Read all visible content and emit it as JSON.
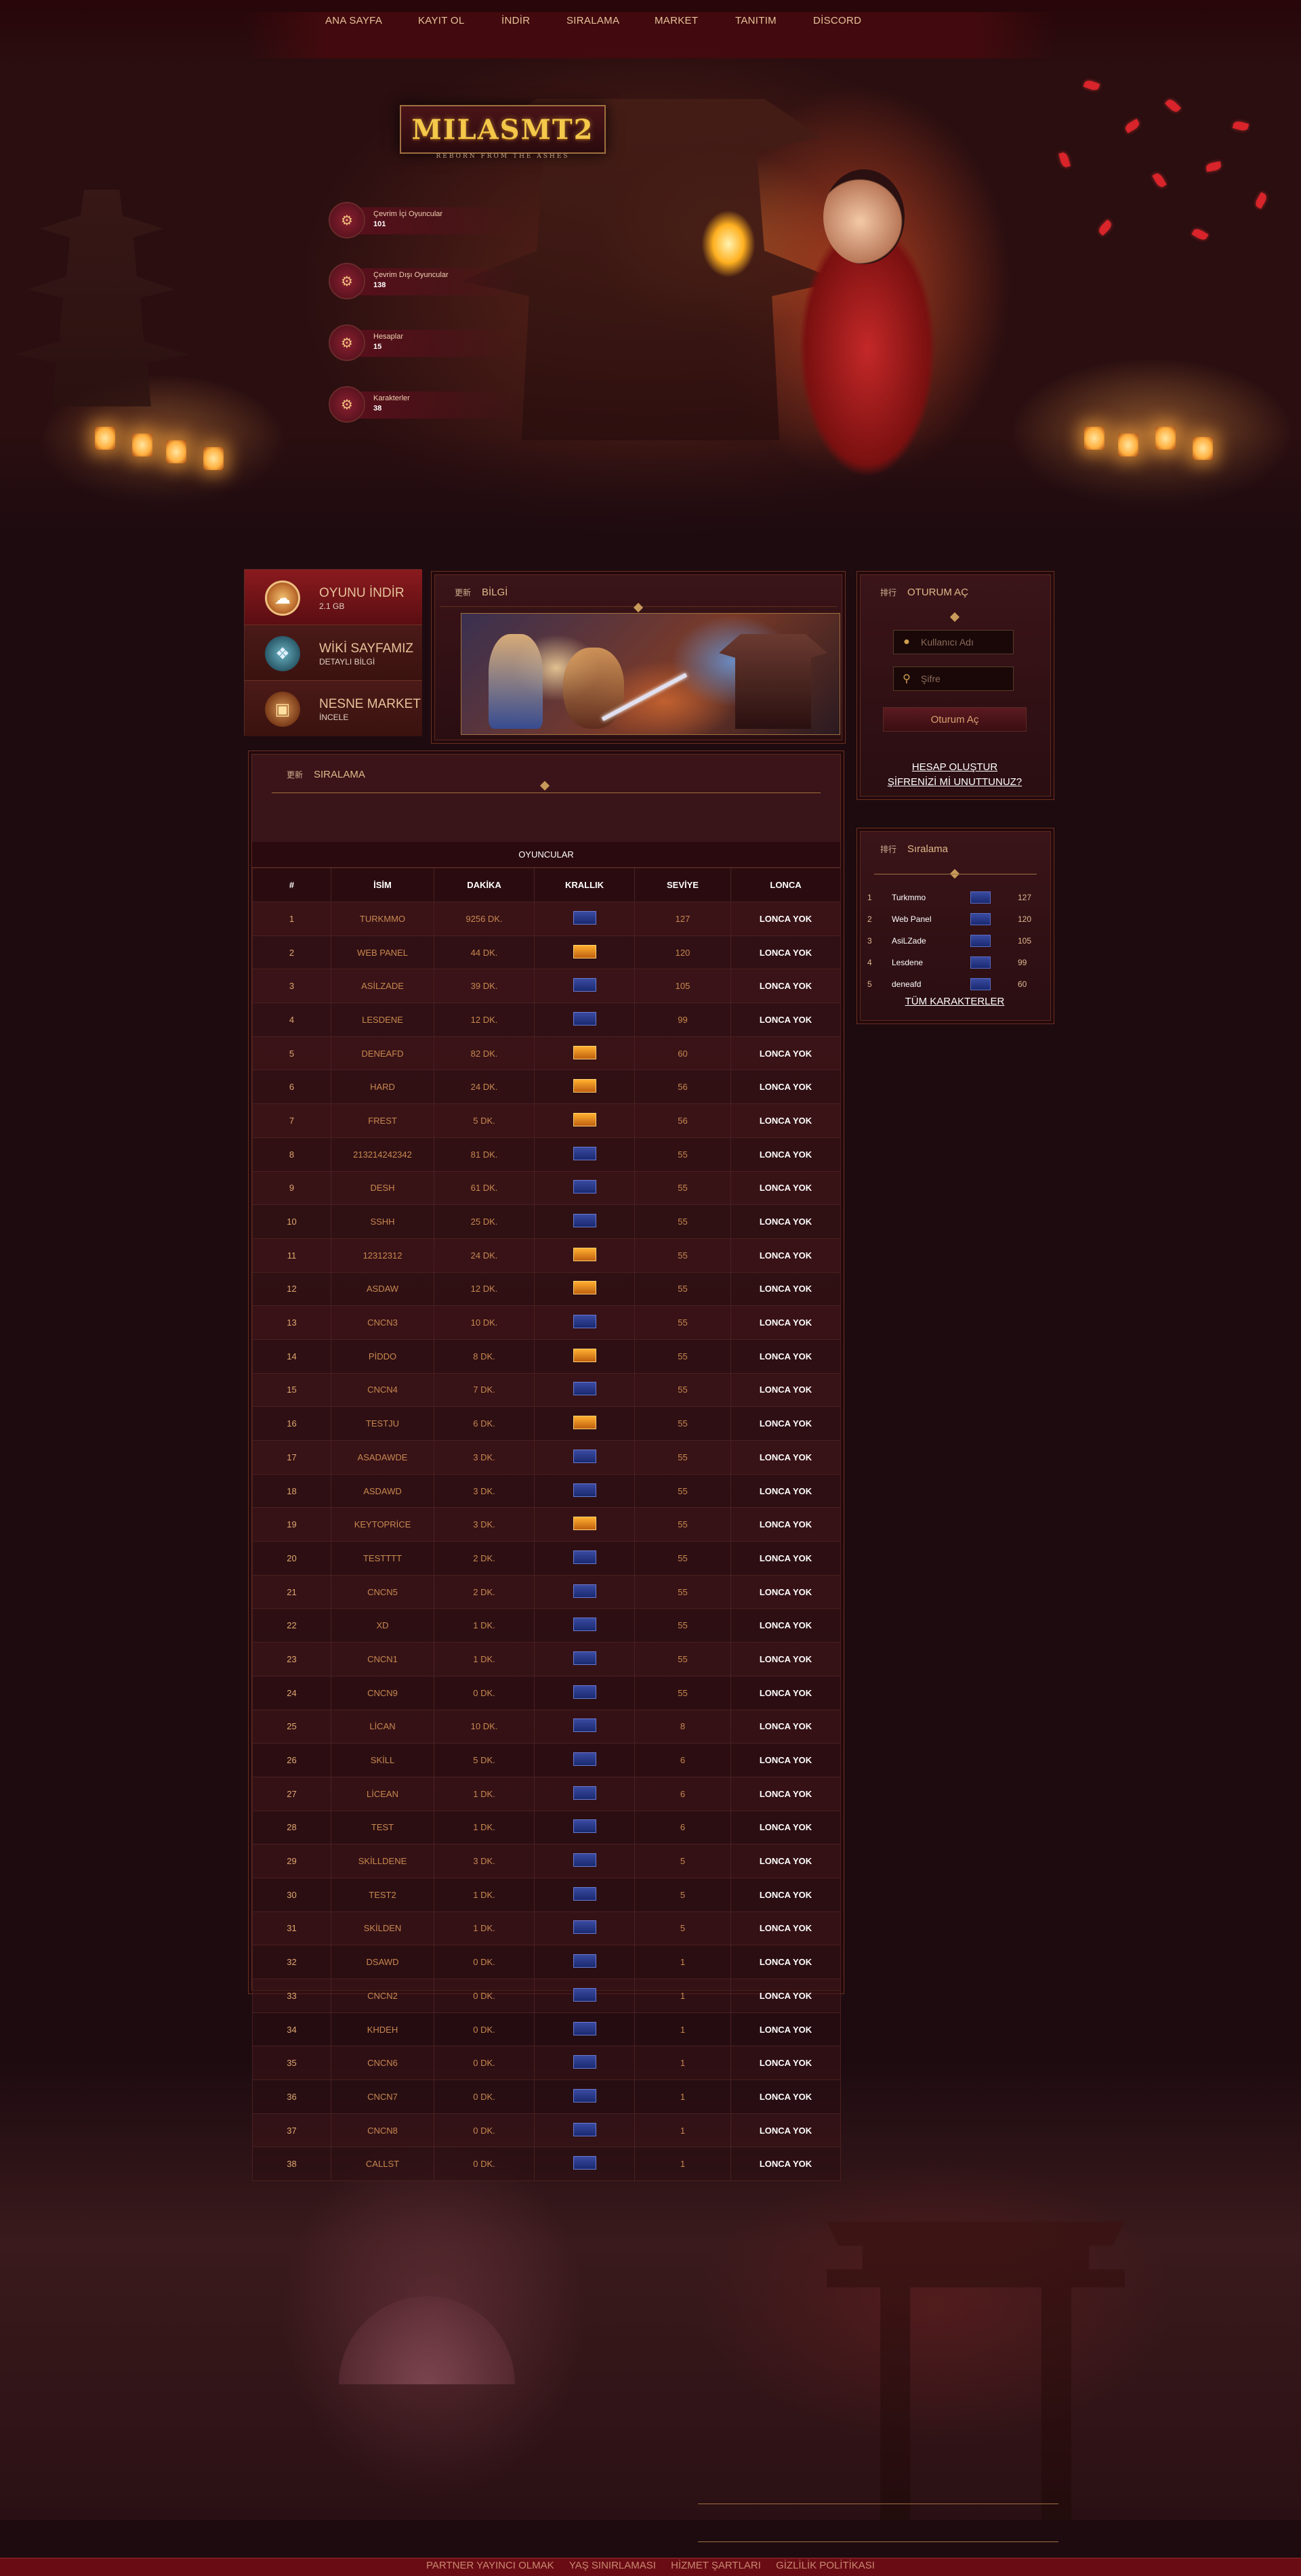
{
  "nav": [
    {
      "label": "ANA SAYFA"
    },
    {
      "label": "KAYIT OL"
    },
    {
      "label": "İNDİR"
    },
    {
      "label": "SIRALAMA"
    },
    {
      "label": "MARKET"
    },
    {
      "label": "TANITIM"
    },
    {
      "label": "DİSCORD"
    }
  ],
  "logo": {
    "text": "MILASMT2",
    "tagline": "REBORN FROM THE ASHES"
  },
  "stats": [
    {
      "label": "Çevrim İçi Oyuncular",
      "value": "101"
    },
    {
      "label": "Çevrim Dışı Oyuncular",
      "value": "138"
    },
    {
      "label": "Hesaplar",
      "value": "15"
    },
    {
      "label": "Karakterler",
      "value": "38"
    }
  ],
  "quick_links": [
    {
      "title": "OYUNU İNDİR",
      "subtitle": "2.1 GB"
    },
    {
      "title": "WİKİ SAYFAMIZ",
      "subtitle": "DETAYLI BİLGİ"
    },
    {
      "title": "NESNE MARKET",
      "subtitle": "İNCELE"
    }
  ],
  "news": {
    "zh": "更新",
    "title": "BİLGİ"
  },
  "login": {
    "zh": "排行",
    "title": "OTURUM AÇ",
    "username_placeholder": "Kullanıcı Adı",
    "password_placeholder": "Şifre",
    "submit_label": "Oturum Aç",
    "create_account": "HESAP OLUŞTUR",
    "forgot_password": "ŞİFRENİZİ Mİ UNUTTUNUZ?"
  },
  "side_ranking": {
    "zh": "排行",
    "title": "Sıralama",
    "all_link": "TÜM KARAKTERLER",
    "rows": [
      {
        "rank": "1",
        "name": "Turkmmo",
        "level": "127"
      },
      {
        "rank": "2",
        "name": "Web Panel",
        "level": "120"
      },
      {
        "rank": "3",
        "name": "AsiLZade",
        "level": "105"
      },
      {
        "rank": "4",
        "name": "Lesdene",
        "level": "99"
      },
      {
        "rank": "5",
        "name": "deneafd",
        "level": "60"
      }
    ]
  },
  "ranking": {
    "zh": "更新",
    "title": "SIRALAMA",
    "table_title": "OYUNCULAR",
    "headers": [
      "#",
      "İSİM",
      "DAKİKA",
      "KRALLIK",
      "SEVİYE",
      "LONCA"
    ],
    "rows": [
      {
        "rank": "1",
        "name": "TURKMMO",
        "minutes": "9256 DK.",
        "kingdom": "blue",
        "level": "127",
        "guild": "LONCA YOK"
      },
      {
        "rank": "2",
        "name": "WEB PANEL",
        "minutes": "44 DK.",
        "kingdom": "red",
        "level": "120",
        "guild": "LONCA YOK"
      },
      {
        "rank": "3",
        "name": "ASİLZADE",
        "minutes": "39 DK.",
        "kingdom": "blue",
        "level": "105",
        "guild": "LONCA YOK"
      },
      {
        "rank": "4",
        "name": "LESDENE",
        "minutes": "12 DK.",
        "kingdom": "blue",
        "level": "99",
        "guild": "LONCA YOK"
      },
      {
        "rank": "5",
        "name": "DENEAFD",
        "minutes": "82 DK.",
        "kingdom": "red",
        "level": "60",
        "guild": "LONCA YOK"
      },
      {
        "rank": "6",
        "name": "HARD",
        "minutes": "24 DK.",
        "kingdom": "red",
        "level": "56",
        "guild": "LONCA YOK"
      },
      {
        "rank": "7",
        "name": "FREST",
        "minutes": "5 DK.",
        "kingdom": "red",
        "level": "56",
        "guild": "LONCA YOK"
      },
      {
        "rank": "8",
        "name": "213214242342",
        "minutes": "81 DK.",
        "kingdom": "blue",
        "level": "55",
        "guild": "LONCA YOK"
      },
      {
        "rank": "9",
        "name": "DESH",
        "minutes": "61 DK.",
        "kingdom": "blue",
        "level": "55",
        "guild": "LONCA YOK"
      },
      {
        "rank": "10",
        "name": "SSHH",
        "minutes": "25 DK.",
        "kingdom": "blue",
        "level": "55",
        "guild": "LONCA YOK"
      },
      {
        "rank": "11",
        "name": "12312312",
        "minutes": "24 DK.",
        "kingdom": "red",
        "level": "55",
        "guild": "LONCA YOK"
      },
      {
        "rank": "12",
        "name": "ASDAW",
        "minutes": "12 DK.",
        "kingdom": "red",
        "level": "55",
        "guild": "LONCA YOK"
      },
      {
        "rank": "13",
        "name": "CNCN3",
        "minutes": "10 DK.",
        "kingdom": "blue",
        "level": "55",
        "guild": "LONCA YOK"
      },
      {
        "rank": "14",
        "name": "PİDDO",
        "minutes": "8 DK.",
        "kingdom": "red",
        "level": "55",
        "guild": "LONCA YOK"
      },
      {
        "rank": "15",
        "name": "CNCN4",
        "minutes": "7 DK.",
        "kingdom": "blue",
        "level": "55",
        "guild": "LONCA YOK"
      },
      {
        "rank": "16",
        "name": "TESTJU",
        "minutes": "6 DK.",
        "kingdom": "red",
        "level": "55",
        "guild": "LONCA YOK"
      },
      {
        "rank": "17",
        "name": "ASADAWDE",
        "minutes": "3 DK.",
        "kingdom": "blue",
        "level": "55",
        "guild": "LONCA YOK"
      },
      {
        "rank": "18",
        "name": "ASDAWD",
        "minutes": "3 DK.",
        "kingdom": "blue",
        "level": "55",
        "guild": "LONCA YOK"
      },
      {
        "rank": "19",
        "name": "KEYTOPRİCE",
        "minutes": "3 DK.",
        "kingdom": "red",
        "level": "55",
        "guild": "LONCA YOK"
      },
      {
        "rank": "20",
        "name": "TESTTTT",
        "minutes": "2 DK.",
        "kingdom": "blue",
        "level": "55",
        "guild": "LONCA YOK"
      },
      {
        "rank": "21",
        "name": "CNCN5",
        "minutes": "2 DK.",
        "kingdom": "blue",
        "level": "55",
        "guild": "LONCA YOK"
      },
      {
        "rank": "22",
        "name": "XD",
        "minutes": "1 DK.",
        "kingdom": "blue",
        "level": "55",
        "guild": "LONCA YOK"
      },
      {
        "rank": "23",
        "name": "CNCN1",
        "minutes": "1 DK.",
        "kingdom": "blue",
        "level": "55",
        "guild": "LONCA YOK"
      },
      {
        "rank": "24",
        "name": "CNCN9",
        "minutes": "0 DK.",
        "kingdom": "blue",
        "level": "55",
        "guild": "LONCA YOK"
      },
      {
        "rank": "25",
        "name": "LİCAN",
        "minutes": "10 DK.",
        "kingdom": "blue",
        "level": "8",
        "guild": "LONCA YOK"
      },
      {
        "rank": "26",
        "name": "SKİLL",
        "minutes": "5 DK.",
        "kingdom": "blue",
        "level": "6",
        "guild": "LONCA YOK"
      },
      {
        "rank": "27",
        "name": "LİCEAN",
        "minutes": "1 DK.",
        "kingdom": "blue",
        "level": "6",
        "guild": "LONCA YOK"
      },
      {
        "rank": "28",
        "name": "TEST",
        "minutes": "1 DK.",
        "kingdom": "blue",
        "level": "6",
        "guild": "LONCA YOK"
      },
      {
        "rank": "29",
        "name": "SKİLLDENE",
        "minutes": "3 DK.",
        "kingdom": "blue",
        "level": "5",
        "guild": "LONCA YOK"
      },
      {
        "rank": "30",
        "name": "TEST2",
        "minutes": "1 DK.",
        "kingdom": "blue",
        "level": "5",
        "guild": "LONCA YOK"
      },
      {
        "rank": "31",
        "name": "SKİLDEN",
        "minutes": "1 DK.",
        "kingdom": "blue",
        "level": "5",
        "guild": "LONCA YOK"
      },
      {
        "rank": "32",
        "name": "DSAWD",
        "minutes": "0 DK.",
        "kingdom": "blue",
        "level": "1",
        "guild": "LONCA YOK"
      },
      {
        "rank": "33",
        "name": "CNCN2",
        "minutes": "0 DK.",
        "kingdom": "blue",
        "level": "1",
        "guild": "LONCA YOK"
      },
      {
        "rank": "34",
        "name": "KHDEH",
        "minutes": "0 DK.",
        "kingdom": "blue",
        "level": "1",
        "guild": "LONCA YOK"
      },
      {
        "rank": "35",
        "name": "CNCN6",
        "minutes": "0 DK.",
        "kingdom": "blue",
        "level": "1",
        "guild": "LONCA YOK"
      },
      {
        "rank": "36",
        "name": "CNCN7",
        "minutes": "0 DK.",
        "kingdom": "blue",
        "level": "1",
        "guild": "LONCA YOK"
      },
      {
        "rank": "37",
        "name": "CNCN8",
        "minutes": "0 DK.",
        "kingdom": "blue",
        "level": "1",
        "guild": "LONCA YOK"
      },
      {
        "rank": "38",
        "name": "CALLST",
        "minutes": "0 DK.",
        "kingdom": "blue",
        "level": "1",
        "guild": "LONCA YOK"
      }
    ]
  },
  "footer": [
    {
      "label": "PARTNER YAYINCI OLMAK"
    },
    {
      "label": "YAŞ SINIRLAMASI"
    },
    {
      "label": "HİZMET ŞARTLARI"
    },
    {
      "label": "GİZLİLİK POLİTİKASI"
    }
  ],
  "icons": {
    "stat": "users-icon",
    "download": "cloud-download-icon",
    "wiki": "book-icon",
    "market": "chest-icon",
    "username": "user-icon",
    "password": "key-icon"
  },
  "colors": {
    "accent_gold": "#e7c39a",
    "table_text": "#c88850",
    "kingdom_blue": "#2a3a90",
    "kingdom_red": "#f09020",
    "footer_bar": "#6a0c14"
  }
}
